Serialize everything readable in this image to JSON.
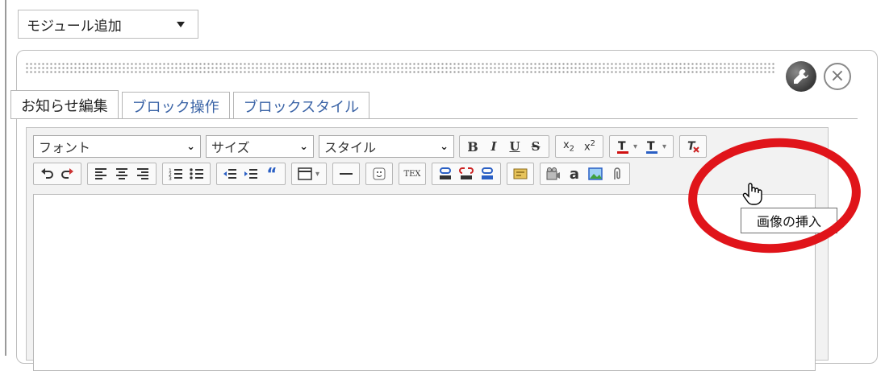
{
  "module_select": {
    "label": "モジュール追加"
  },
  "tabs": [
    {
      "label": "お知らせ編集",
      "active": true
    },
    {
      "label": "ブロック操作",
      "active": false
    },
    {
      "label": "ブロックスタイル",
      "active": false
    }
  ],
  "toolbar": {
    "font_select": "フォント",
    "size_select": "サイズ",
    "style_select": "スタイル",
    "buttons_row1": [
      "B",
      "I",
      "U",
      "S"
    ],
    "tex_label": "TEX",
    "anchor_label": "a"
  },
  "tooltip": {
    "text": "画像の挿入"
  },
  "colors": {
    "highlight_circle": "#e0141a",
    "tab_link": "#3a63a6"
  },
  "icons": [
    "wrench-icon",
    "close-icon",
    "undo-icon",
    "redo-icon",
    "image-insert-icon",
    "hand-cursor-icon"
  ]
}
